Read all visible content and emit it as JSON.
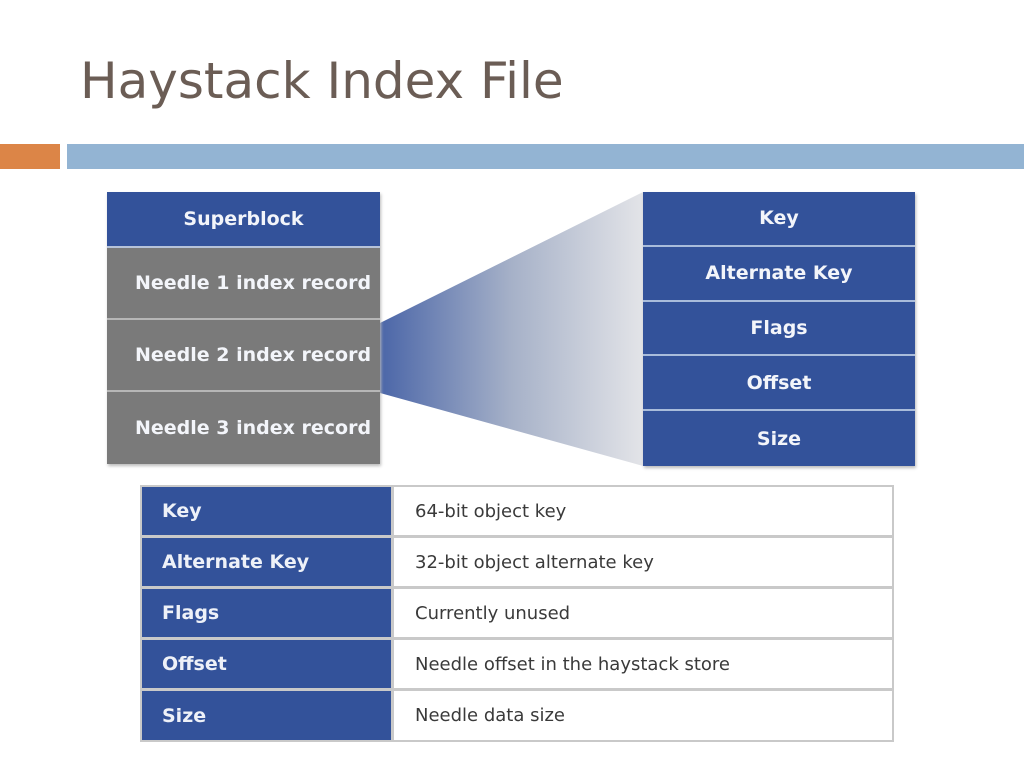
{
  "slide": {
    "title": "Haystack Index File",
    "accent_colors": {
      "orange": "#dc8547",
      "blue": "#93b4d3",
      "diagram_blue": "#33529a",
      "diagram_gray": "#7a7a7a"
    }
  },
  "index_file": {
    "superblock": "Superblock",
    "records": [
      "Needle 1 index record",
      "Needle 2 index record",
      "Needle 3 index record"
    ]
  },
  "record_fields": [
    "Key",
    "Alternate Key",
    "Flags",
    "Offset",
    "Size"
  ],
  "field_table": {
    "rows": [
      {
        "field": "Key",
        "description": "64-bit object key"
      },
      {
        "field": "Alternate Key",
        "description": "32-bit object alternate key"
      },
      {
        "field": "Flags",
        "description": "Currently unused"
      },
      {
        "field": "Offset",
        "description": "Needle offset in the haystack store"
      },
      {
        "field": "Size",
        "description": "Needle data size"
      }
    ]
  }
}
